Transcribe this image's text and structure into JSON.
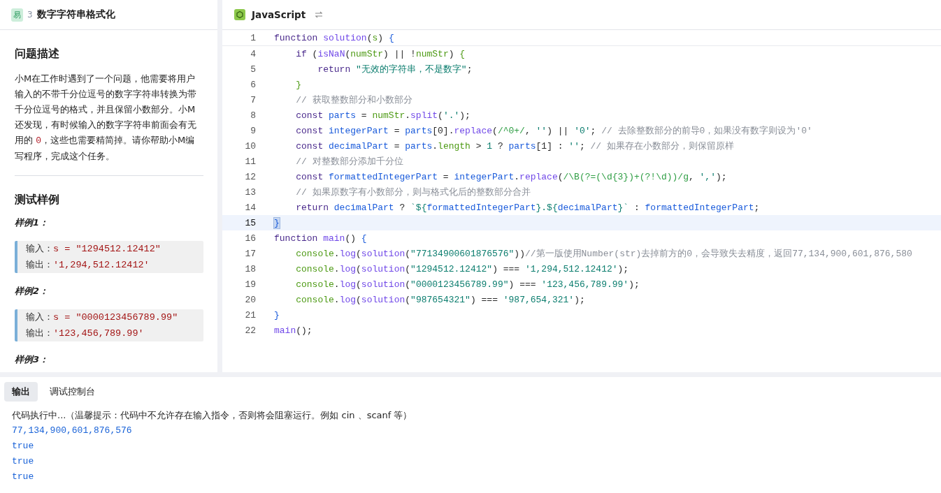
{
  "problem": {
    "difficulty": "易",
    "number": "3",
    "title": "数字字符串格式化"
  },
  "description": {
    "heading": "问题描述",
    "paragraph": [
      {
        "kind": "text",
        "text": "小M在工作时遇到了一个问题，他需要将用户输入的不带千分位逗号的数字字符串转换为带千分位逗号的格式，并且保留小数部分。小M还发现，有时候输入的数字字符串前面会有无用的 "
      },
      {
        "kind": "code",
        "text": "0"
      },
      {
        "kind": "text",
        "text": "，这些也需要精简掉。请你帮助小M编写程序，完成这个任务。"
      }
    ]
  },
  "samples": {
    "heading": "测试样例",
    "items": [
      {
        "label": "样例1：",
        "lines": [
          {
            "label": "输入：",
            "value": "s = \"1294512.12412\""
          },
          {
            "label": "输出：",
            "value": "'1,294,512.12412'"
          }
        ]
      },
      {
        "label": "样例2：",
        "lines": [
          {
            "label": "输入：",
            "value": "s = \"0000123456789.99\""
          },
          {
            "label": "输出：",
            "value": "'123,456,789.99'"
          }
        ]
      },
      {
        "label": "样例3："
      }
    ]
  },
  "editor": {
    "language": "JavaScript",
    "lines": [
      {
        "number": "1",
        "current": false,
        "tokens": [
          {
            "kind": "keyword",
            "text": "function "
          },
          {
            "kind": "func",
            "text": "solution"
          },
          {
            "kind": "punct",
            "text": "("
          },
          {
            "kind": "green",
            "text": "s"
          },
          {
            "kind": "punct",
            "text": ") "
          },
          {
            "kind": "brace",
            "text": "{"
          }
        ]
      },
      {
        "number": "4",
        "current": false,
        "tokens": [
          {
            "kind": "keyword",
            "text": "    if"
          },
          {
            "kind": "punct",
            "text": " ("
          },
          {
            "kind": "func",
            "text": "isNaN"
          },
          {
            "kind": "punct",
            "text": "("
          },
          {
            "kind": "green",
            "text": "numStr"
          },
          {
            "kind": "punct",
            "text": ") || !"
          },
          {
            "kind": "green",
            "text": "numStr"
          },
          {
            "kind": "punct",
            "text": ") "
          },
          {
            "kind": "green",
            "text": "{"
          }
        ]
      },
      {
        "number": "5",
        "current": false,
        "tokens": [
          {
            "kind": "keyword",
            "text": "        return"
          },
          {
            "kind": "string",
            "text": " \"无效的字符串，不是数字\""
          },
          {
            "kind": "punct",
            "text": ";"
          }
        ]
      },
      {
        "number": "6",
        "current": false,
        "tokens": [
          {
            "kind": "green",
            "text": "    }"
          }
        ]
      },
      {
        "number": "7",
        "current": false,
        "tokens": [
          {
            "kind": "comment",
            "text": "    // 获取整数部分和小数部分"
          }
        ]
      },
      {
        "number": "8",
        "current": false,
        "tokens": [
          {
            "kind": "keyword",
            "text": "    const"
          },
          {
            "kind": "variable",
            "text": " parts"
          },
          {
            "kind": "punct",
            "text": " = "
          },
          {
            "kind": "green",
            "text": "numStr"
          },
          {
            "kind": "punct",
            "text": "."
          },
          {
            "kind": "func",
            "text": "split"
          },
          {
            "kind": "punct",
            "text": "("
          },
          {
            "kind": "string",
            "text": "'.'"
          },
          {
            "kind": "punct",
            "text": ");"
          }
        ]
      },
      {
        "number": "9",
        "current": false,
        "tokens": [
          {
            "kind": "keyword",
            "text": "    const"
          },
          {
            "kind": "variable",
            "text": " integerPart"
          },
          {
            "kind": "punct",
            "text": " = "
          },
          {
            "kind": "variable",
            "text": "parts"
          },
          {
            "kind": "punct",
            "text": "[0]."
          },
          {
            "kind": "func",
            "text": "replace"
          },
          {
            "kind": "punct",
            "text": "("
          },
          {
            "kind": "regex",
            "text": "/^0+/"
          },
          {
            "kind": "punct",
            "text": ", "
          },
          {
            "kind": "string",
            "text": "''"
          },
          {
            "kind": "punct",
            "text": ") || "
          },
          {
            "kind": "string",
            "text": "'0'"
          },
          {
            "kind": "punct",
            "text": "; "
          },
          {
            "kind": "comment",
            "text": "// 去除整数部分的前导0，如果没有数字则设为'0'"
          }
        ]
      },
      {
        "number": "10",
        "current": false,
        "tokens": [
          {
            "kind": "keyword",
            "text": "    const"
          },
          {
            "kind": "variable",
            "text": " decimalPart"
          },
          {
            "kind": "punct",
            "text": " = "
          },
          {
            "kind": "variable",
            "text": "parts"
          },
          {
            "kind": "punct",
            "text": "."
          },
          {
            "kind": "green",
            "text": "length"
          },
          {
            "kind": "punct",
            "text": " > "
          },
          {
            "kind": "string",
            "text": "1"
          },
          {
            "kind": "punct",
            "text": " ? "
          },
          {
            "kind": "variable",
            "text": "parts"
          },
          {
            "kind": "punct",
            "text": "[1] : "
          },
          {
            "kind": "string",
            "text": "''"
          },
          {
            "kind": "punct",
            "text": "; "
          },
          {
            "kind": "comment",
            "text": "// 如果存在小数部分，则保留原样"
          }
        ]
      },
      {
        "number": "11",
        "current": false,
        "tokens": [
          {
            "kind": "comment",
            "text": "    // 对整数部分添加千分位"
          }
        ]
      },
      {
        "number": "12",
        "current": false,
        "tokens": [
          {
            "kind": "keyword",
            "text": "    const"
          },
          {
            "kind": "variable",
            "text": " formattedIntegerPart"
          },
          {
            "kind": "punct",
            "text": " = "
          },
          {
            "kind": "variable",
            "text": "integerPart"
          },
          {
            "kind": "punct",
            "text": "."
          },
          {
            "kind": "func",
            "text": "replace"
          },
          {
            "kind": "punct",
            "text": "("
          },
          {
            "kind": "regex",
            "text": "/\\B(?=(\\d{3})+(?!\\d))/g"
          },
          {
            "kind": "punct",
            "text": ", "
          },
          {
            "kind": "string",
            "text": "','"
          },
          {
            "kind": "punct",
            "text": ");"
          }
        ]
      },
      {
        "number": "13",
        "current": false,
        "tokens": [
          {
            "kind": "comment",
            "text": "    // 如果原数字有小数部分，则与格式化后的整数部分合并"
          }
        ]
      },
      {
        "number": "14",
        "current": false,
        "tokens": [
          {
            "kind": "keyword",
            "text": "    return"
          },
          {
            "kind": "variable",
            "text": " decimalPart"
          },
          {
            "kind": "punct",
            "text": " ? "
          },
          {
            "kind": "string",
            "text": "`${"
          },
          {
            "kind": "variable",
            "text": "formattedIntegerPart"
          },
          {
            "kind": "string",
            "text": "}.${"
          },
          {
            "kind": "variable",
            "text": "decimalPart"
          },
          {
            "kind": "string",
            "text": "}`"
          },
          {
            "kind": "punct",
            "text": " : "
          },
          {
            "kind": "variable",
            "text": "formattedIntegerPart"
          },
          {
            "kind": "punct",
            "text": ";"
          }
        ]
      },
      {
        "number": "15",
        "current": true,
        "tokens": [
          {
            "kind": "brace",
            "text": "}"
          }
        ]
      },
      {
        "number": "16",
        "current": false,
        "tokens": [
          {
            "kind": "keyword",
            "text": "function "
          },
          {
            "kind": "func",
            "text": "main"
          },
          {
            "kind": "punct",
            "text": "() "
          },
          {
            "kind": "brace",
            "text": "{"
          }
        ]
      },
      {
        "number": "17",
        "current": false,
        "tokens": [
          {
            "kind": "green",
            "text": "    console"
          },
          {
            "kind": "punct",
            "text": "."
          },
          {
            "kind": "func",
            "text": "log"
          },
          {
            "kind": "punct",
            "text": "("
          },
          {
            "kind": "func",
            "text": "solution"
          },
          {
            "kind": "punct",
            "text": "("
          },
          {
            "kind": "string",
            "text": "\"77134900601876576\""
          },
          {
            "kind": "punct",
            "text": "))"
          },
          {
            "kind": "comment",
            "text": "//第一版使用Number(str)去掉前方的0，会导致失去精度，返回77,134,900,601,876,580"
          }
        ]
      },
      {
        "number": "18",
        "current": false,
        "tokens": [
          {
            "kind": "green",
            "text": "    console"
          },
          {
            "kind": "punct",
            "text": "."
          },
          {
            "kind": "func",
            "text": "log"
          },
          {
            "kind": "punct",
            "text": "("
          },
          {
            "kind": "func",
            "text": "solution"
          },
          {
            "kind": "punct",
            "text": "("
          },
          {
            "kind": "string",
            "text": "\"1294512.12412\""
          },
          {
            "kind": "punct",
            "text": ") === "
          },
          {
            "kind": "string",
            "text": "'1,294,512.12412'"
          },
          {
            "kind": "punct",
            "text": ");"
          }
        ]
      },
      {
        "number": "19",
        "current": false,
        "tokens": [
          {
            "kind": "green",
            "text": "    console"
          },
          {
            "kind": "punct",
            "text": "."
          },
          {
            "kind": "func",
            "text": "log"
          },
          {
            "kind": "punct",
            "text": "("
          },
          {
            "kind": "func",
            "text": "solution"
          },
          {
            "kind": "punct",
            "text": "("
          },
          {
            "kind": "string",
            "text": "\"0000123456789.99\""
          },
          {
            "kind": "punct",
            "text": ") === "
          },
          {
            "kind": "string",
            "text": "'123,456,789.99'"
          },
          {
            "kind": "punct",
            "text": ");"
          }
        ]
      },
      {
        "number": "20",
        "current": false,
        "tokens": [
          {
            "kind": "green",
            "text": "    console"
          },
          {
            "kind": "punct",
            "text": "."
          },
          {
            "kind": "func",
            "text": "log"
          },
          {
            "kind": "punct",
            "text": "("
          },
          {
            "kind": "func",
            "text": "solution"
          },
          {
            "kind": "punct",
            "text": "("
          },
          {
            "kind": "string",
            "text": "\"987654321\""
          },
          {
            "kind": "punct",
            "text": ") === "
          },
          {
            "kind": "string",
            "text": "'987,654,321'"
          },
          {
            "kind": "punct",
            "text": ");"
          }
        ]
      },
      {
        "number": "21",
        "current": false,
        "tokens": [
          {
            "kind": "brace",
            "text": "}"
          }
        ]
      },
      {
        "number": "22",
        "current": false,
        "tokens": [
          {
            "kind": "func",
            "text": "main"
          },
          {
            "kind": "punct",
            "text": "();"
          }
        ]
      }
    ]
  },
  "console": {
    "tabs": [
      {
        "label": "输出",
        "selected": true
      },
      {
        "label": "调试控制台",
        "selected": false
      }
    ],
    "lines": [
      {
        "kind": "info",
        "text": "代码执行中...（温馨提示：代码中不允许存在输入指令，否则将会阻塞运行。例如 cin 、scanf 等）"
      },
      {
        "kind": "result",
        "text": "77,134,900,601,876,576"
      },
      {
        "kind": "result",
        "text": "true"
      },
      {
        "kind": "result",
        "text": "true"
      },
      {
        "kind": "result",
        "text": "true"
      }
    ]
  }
}
